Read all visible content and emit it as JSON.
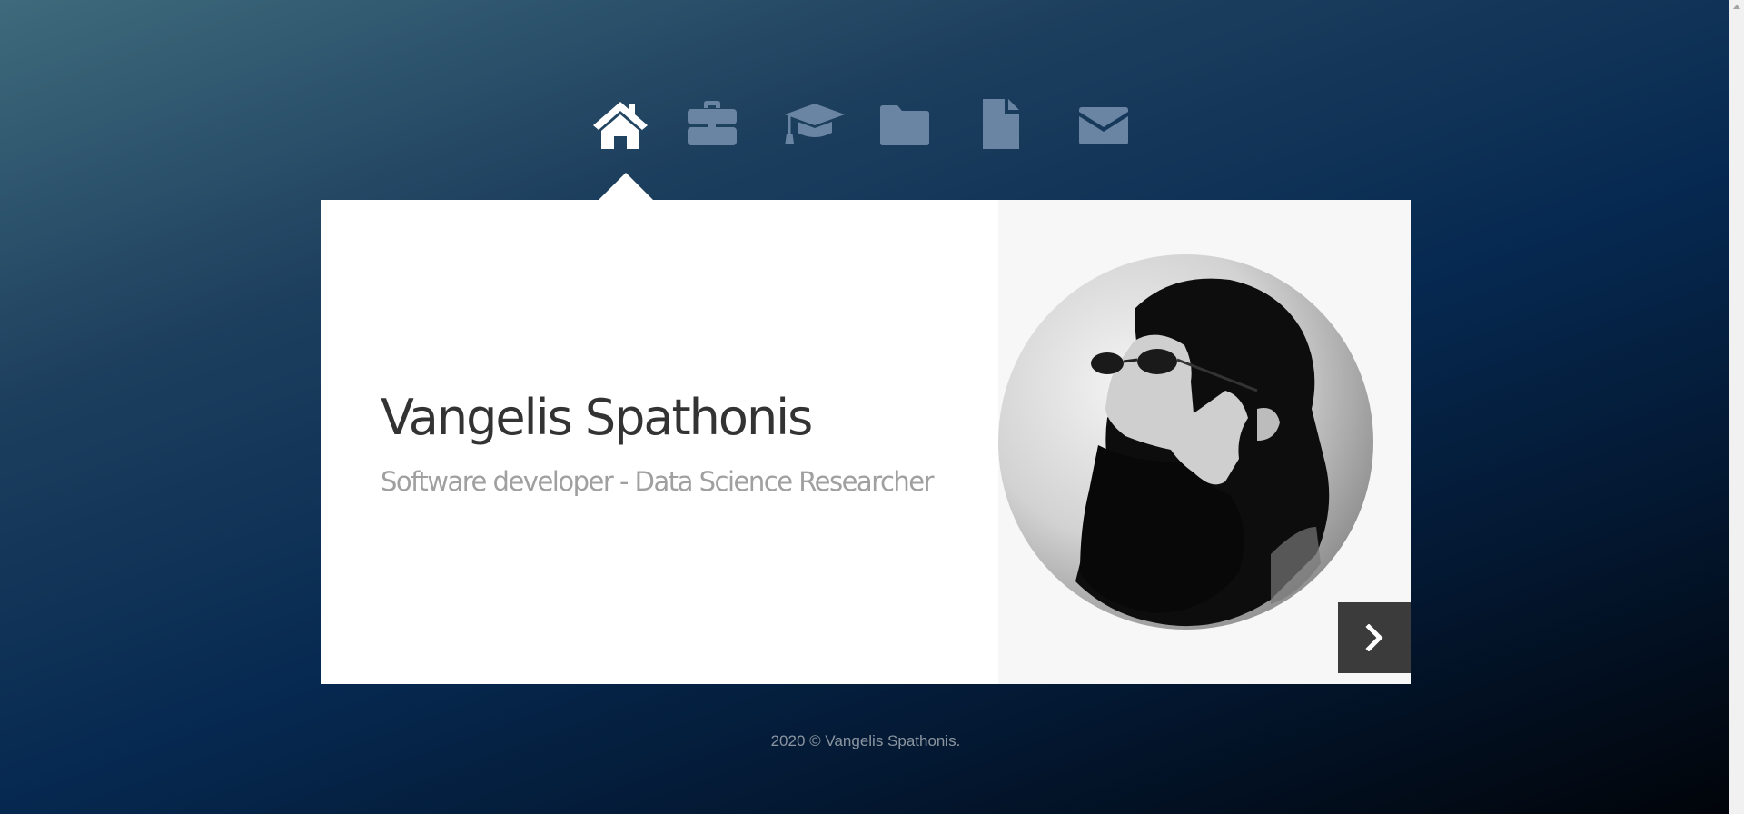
{
  "nav": {
    "items": [
      {
        "icon": "home-icon",
        "active": true
      },
      {
        "icon": "briefcase-icon",
        "active": false
      },
      {
        "icon": "graduation-cap-icon",
        "active": false
      },
      {
        "icon": "folder-icon",
        "active": false
      },
      {
        "icon": "document-icon",
        "active": false
      },
      {
        "icon": "envelope-icon",
        "active": false
      }
    ],
    "active_color": "#ffffff",
    "inactive_color": "#6a85a3"
  },
  "profile": {
    "name": "Vangelis Spathonis",
    "subtitle": "Software developer - Data Science Researcher"
  },
  "next_button": {
    "icon": "chevron-right-icon",
    "color": "#3b3b3b"
  },
  "footer": {
    "text": "2020 © Vangelis Spathonis."
  }
}
